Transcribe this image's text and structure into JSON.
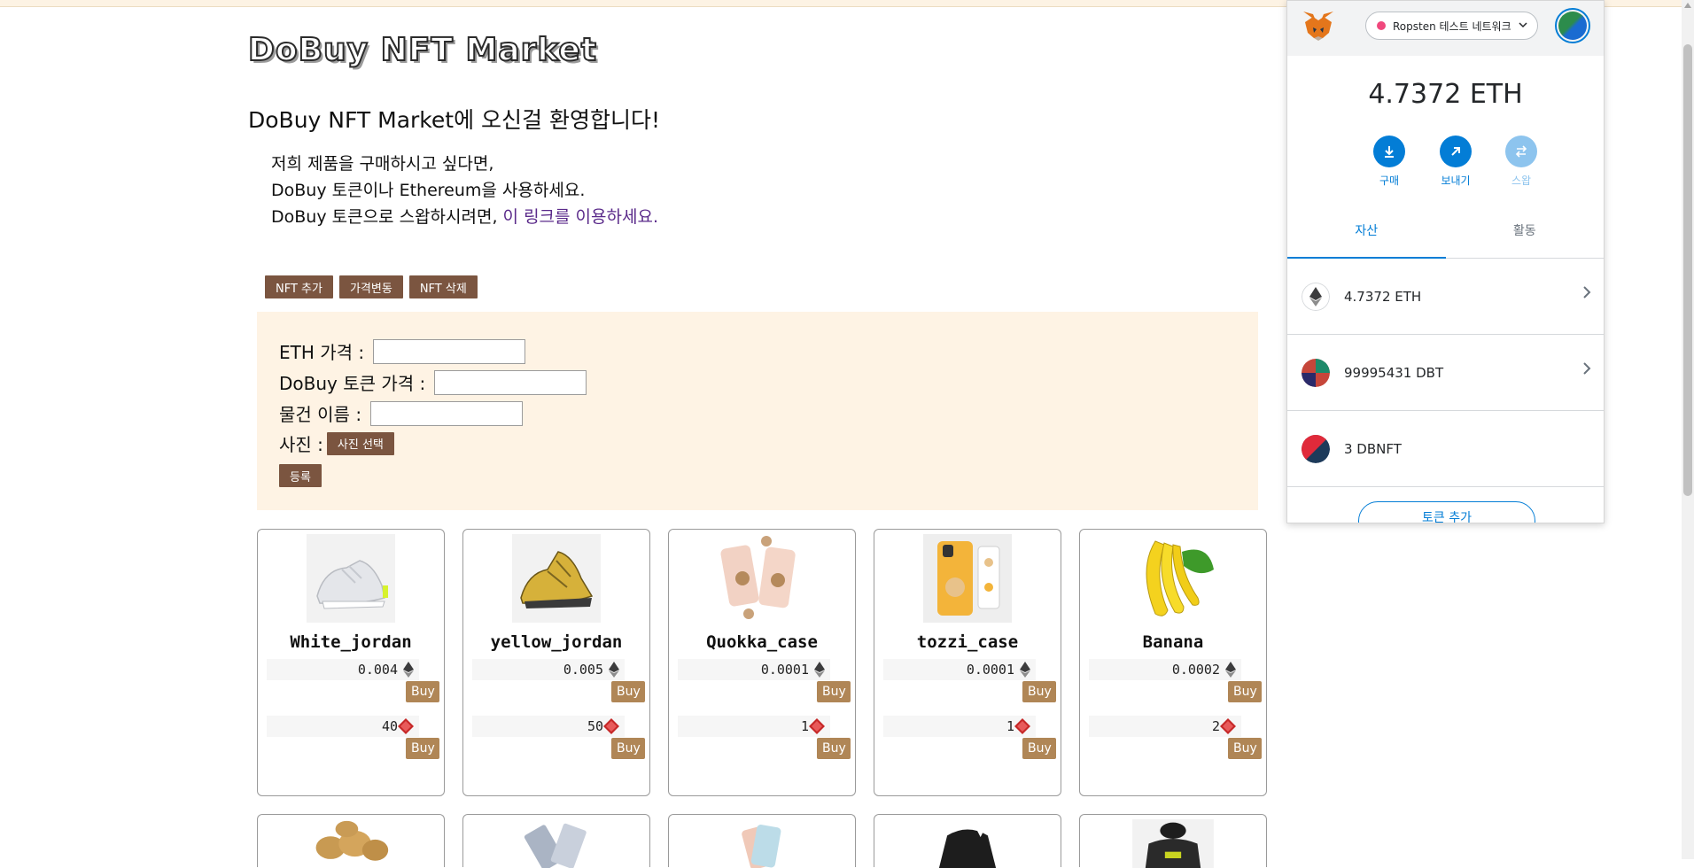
{
  "site": {
    "title": "DoBuy NFT Market",
    "welcome": "DoBuy NFT Market에 오신걸 환영합니다!",
    "intro_line1": "저희 제품을 구매하시고 싶다면,",
    "intro_line2": "DoBuy 토큰이나 Ethereum을 사용하세요.",
    "intro_line3_prefix": "DoBuy 토큰으로 스왑하시려면, ",
    "intro_line3_link": "이 링크를 이용하세요."
  },
  "admin": {
    "add_label": "NFT 추가",
    "price_change_label": "가격변동",
    "delete_label": "NFT 삭제"
  },
  "form": {
    "eth_price_label": "ETH 가격 :",
    "dbt_price_label": "DoBuy 토큰 가격 :",
    "item_name_label": "물건 이름 :",
    "photo_label": "사진 :",
    "photo_button": "사진 선택",
    "submit_button": "등록",
    "eth_price_value": "",
    "dbt_price_value": "",
    "item_name_value": ""
  },
  "products": [
    {
      "name": "White_jordan",
      "eth_price": "0.004",
      "dbt_price": "40",
      "buy_label": "Buy"
    },
    {
      "name": "yellow_jordan",
      "eth_price": "0.005",
      "dbt_price": "50",
      "buy_label": "Buy"
    },
    {
      "name": "Quokka_case",
      "eth_price": "0.0001",
      "dbt_price": "1",
      "buy_label": "Buy"
    },
    {
      "name": "tozzi_case",
      "eth_price": "0.0001",
      "dbt_price": "1",
      "buy_label": "Buy"
    },
    {
      "name": "Banana",
      "eth_price": "0.0002",
      "dbt_price": "2",
      "buy_label": "Buy"
    }
  ],
  "wallet": {
    "network": "Ropsten 테스트 네트워크",
    "balance": "4.7372 ETH",
    "buy_label": "구매",
    "send_label": "보내기",
    "swap_label": "스왑",
    "tab_assets": "자산",
    "tab_activity": "활동",
    "assets": [
      {
        "label": "4.7372 ETH"
      },
      {
        "label": "99995431 DBT"
      },
      {
        "label": "3 DBNFT"
      }
    ],
    "add_token_label": "토큰 추가"
  },
  "colors": {
    "button_dark": "#7b5540",
    "buy_button": "#b08656",
    "form_bg": "#fef3e4",
    "link": "#5a2a8a",
    "wallet_accent": "#037dd6"
  }
}
